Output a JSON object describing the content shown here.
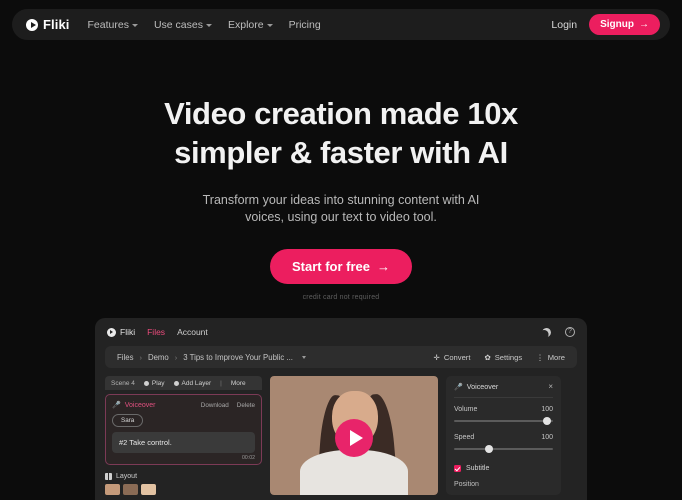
{
  "brand": {
    "name": "Fliki",
    "logo_icon": "play-circle-icon"
  },
  "nav": {
    "links": [
      {
        "label": "Features",
        "has_caret": true
      },
      {
        "label": "Use cases",
        "has_caret": true
      },
      {
        "label": "Explore",
        "has_caret": true
      },
      {
        "label": "Pricing",
        "has_caret": false
      }
    ],
    "login_label": "Login",
    "signup_label": "Signup",
    "signup_arrow": "→"
  },
  "hero": {
    "title_line1": "Video creation made 10x",
    "title_line2": "simpler & faster with AI",
    "subtitle_line1": "Transform your ideas into stunning content with AI",
    "subtitle_line2": "voices, using our text to video tool.",
    "cta_label": "Start for free",
    "cta_arrow": "→",
    "note": "credit card not required"
  },
  "app": {
    "brand_name": "Fliki",
    "tabs": [
      {
        "label": "Files",
        "active": true
      },
      {
        "label": "Account",
        "active": false
      }
    ],
    "top_icons": [
      {
        "name": "moon-icon"
      },
      {
        "name": "help-icon",
        "glyph": "?"
      }
    ],
    "breadcrumb": {
      "items": [
        "Files",
        "Demo",
        "3 Tips to Improve Your Public ..."
      ],
      "separator": "›"
    },
    "toolbar": [
      {
        "label": "Convert",
        "icon": "convert-icon",
        "glyph": "✛"
      },
      {
        "label": "Settings",
        "icon": "gear-icon",
        "glyph": "✿"
      },
      {
        "label": "More",
        "icon": "more-icon",
        "glyph": "⋮"
      }
    ],
    "scene": {
      "name": "Scene 4",
      "actions": [
        {
          "label": "Play",
          "icon": "play-icon"
        },
        {
          "label": "Add Layer",
          "icon": "add-layer-icon"
        },
        {
          "label": "More",
          "icon": "more-icon"
        }
      ]
    },
    "voiceover_card": {
      "title": "Voiceover",
      "icon": "microphone-icon",
      "download_label": "Download",
      "delete_label": "Delete",
      "voice_chip": "Sara",
      "text_value": "#2 Take control.",
      "duration": "00:02"
    },
    "layout_section": {
      "label": "Layout",
      "icon": "layout-icon"
    },
    "preview": {
      "play_button_icon": "play-icon"
    },
    "right_panel": {
      "title": "Voiceover",
      "icon": "microphone-icon",
      "close_icon": "close-icon",
      "close_glyph": "×",
      "controls": [
        {
          "label": "Volume",
          "value": "100",
          "knob_pct": 93
        },
        {
          "label": "Speed",
          "value": "100",
          "knob_pct": 33
        }
      ],
      "subtitle_label": "Subtitle",
      "subtitle_checked": true,
      "position_label": "Position"
    }
  },
  "colors": {
    "accent": "#ec1e5f",
    "background": "#0c0c0c",
    "navbar": "#1d1d1d",
    "app_bg": "#232323"
  }
}
